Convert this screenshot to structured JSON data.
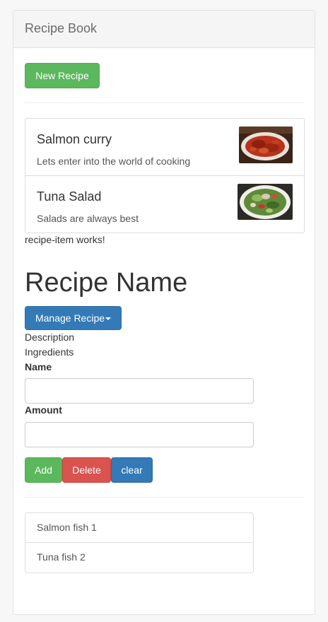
{
  "header": {
    "title": "Recipe Book"
  },
  "toolbar": {
    "new_recipe_label": "New Recipe"
  },
  "recipes": [
    {
      "name": "Salmon curry",
      "description": "Lets enter into the world of cooking",
      "image": "salmon-curry-photo"
    },
    {
      "name": "Tuna Salad",
      "description": "Salads are always best",
      "image": "tuna-salad-photo"
    }
  ],
  "recipe_item_text": "recipe-item works!",
  "detail": {
    "title": "Recipe Name",
    "manage_label": "Manage Recipe",
    "description_label": "Description",
    "ingredients_label": "Ingredients"
  },
  "form": {
    "name_label": "Name",
    "name_value": "",
    "amount_label": "Amount",
    "amount_value": "",
    "add_label": "Add",
    "delete_label": "Delete",
    "clear_label": "clear"
  },
  "shopping_list": [
    {
      "text": "Salmon fish 1"
    },
    {
      "text": "Tuna fish 2"
    }
  ],
  "colors": {
    "success": "#5cb85c",
    "danger": "#d9534f",
    "primary": "#337ab7"
  }
}
